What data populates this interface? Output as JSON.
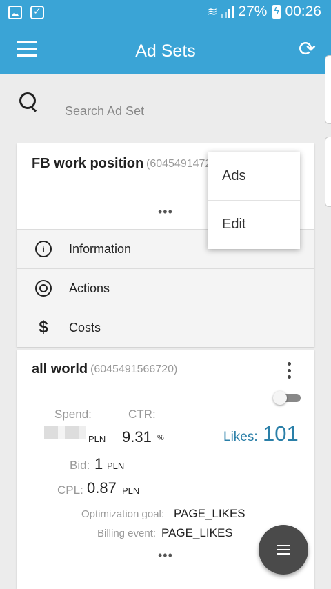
{
  "status_bar": {
    "battery": "27%",
    "time": "00:26",
    "icons": [
      "image-icon",
      "briefcase-icon",
      "wifi-icon",
      "signal-icon",
      "battery-charging-icon"
    ]
  },
  "app_bar": {
    "title": "Ad Sets",
    "menu_icon": "hamburger-menu-icon",
    "refresh_icon": "refresh-icon"
  },
  "search": {
    "placeholder": "Search Ad Set",
    "value": ""
  },
  "ad_sets": [
    {
      "name": "FB work position",
      "id": "(6045491472",
      "more": "•••",
      "actions": [
        {
          "label": "Information",
          "icon": "info-icon"
        },
        {
          "label": "Actions",
          "icon": "target-icon"
        },
        {
          "label": "Costs",
          "icon": "dollar-icon"
        }
      ]
    },
    {
      "name": "all world",
      "id": "(6045491566720)",
      "enabled": false,
      "spend_label": "Spend:",
      "spend_unit": "PLN",
      "ctr_label": "CTR:",
      "ctr_value": "9.31",
      "ctr_unit": "%",
      "likes_label": "Likes:",
      "likes_value": "101",
      "bid_label": "Bid:",
      "bid_value": "1",
      "bid_unit": "PLN",
      "cpl_label": "CPL:",
      "cpl_value": "0.87",
      "cpl_unit": "PLN",
      "optimization_label": "Optimization goal:",
      "optimization_value": "PAGE_LIKES",
      "billing_label": "Billing event:",
      "billing_value": "PAGE_LIKES",
      "more": "•••"
    }
  ],
  "popup_menu": {
    "items": [
      "Ads",
      "Edit"
    ]
  },
  "colors": {
    "primary": "#3aa4d6",
    "likes": "#2a7fa8",
    "fab": "#4a4a4a"
  }
}
